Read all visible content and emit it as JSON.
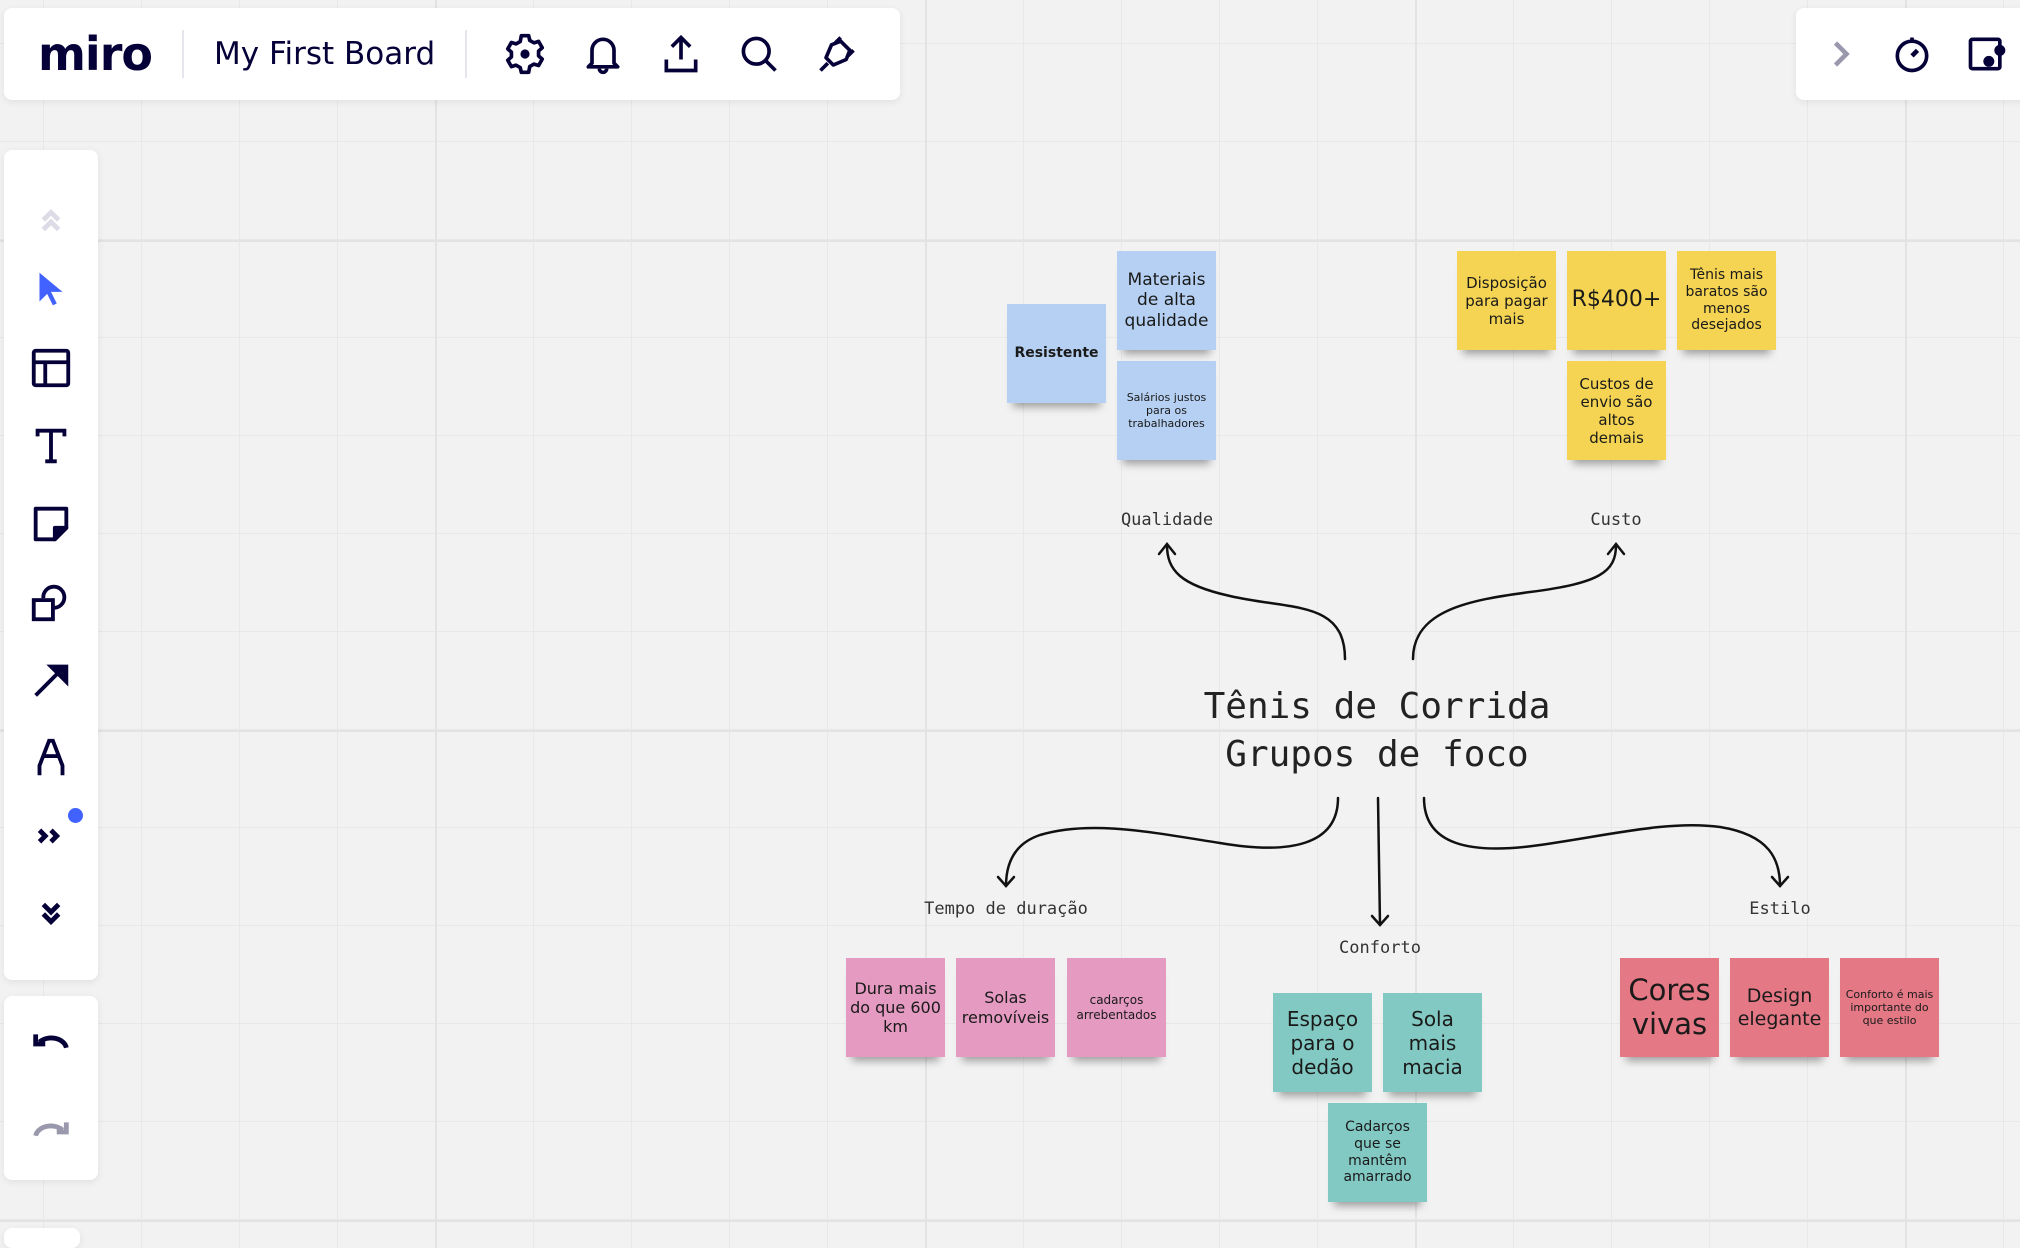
{
  "app": {
    "logo": "miro",
    "board_title": "My First Board"
  },
  "top_toolbar": {
    "icons": [
      "settings-icon",
      "notifications-icon",
      "export-icon",
      "search-icon",
      "integrations-icon"
    ]
  },
  "right_toolbar": {
    "icons": [
      "chevron-right-icon",
      "timer-icon",
      "present-icon"
    ]
  },
  "left_toolbar": {
    "tools": [
      "collapse-up-icon",
      "select-icon",
      "templates-icon",
      "text-icon",
      "sticky-note-icon",
      "shapes-icon",
      "connector-icon",
      "pen-icon",
      "more-tools-icon",
      "expand-down-icon"
    ],
    "accent": "#4262ff"
  },
  "history": {
    "undo": "undo-icon",
    "redo": "redo-icon"
  },
  "board": {
    "title_line1": "Tênis de Corrida",
    "title_line2": "Grupos de foco",
    "groups": [
      {
        "label": "Qualidade",
        "color": "#b5d0f2",
        "notes": [
          "Resistente",
          "Materiais de alta qualidade",
          "Salários justos para os trabalhadores"
        ]
      },
      {
        "label": "Custo",
        "color": "#f4d452",
        "notes": [
          "Disposição para pagar mais",
          "R$400+",
          "Tênis mais baratos são menos desejados",
          "Custos de envio são altos demais"
        ]
      },
      {
        "label": "Tempo de duração",
        "color": "#e49ac1",
        "notes": [
          "Dura mais do que 600 km",
          "Solas removíveis",
          "cadarços arrebentados"
        ]
      },
      {
        "label": "Conforto",
        "color": "#82c9c3",
        "notes": [
          "Espaço para o dedão",
          "Sola mais macia",
          "Cadarços que se mantêm amarrado"
        ]
      },
      {
        "label": "Estilo",
        "color": "#e47885",
        "notes": [
          "Cores vivas",
          "Design elegante",
          "Conforto é mais importante do que estilo"
        ]
      }
    ]
  }
}
